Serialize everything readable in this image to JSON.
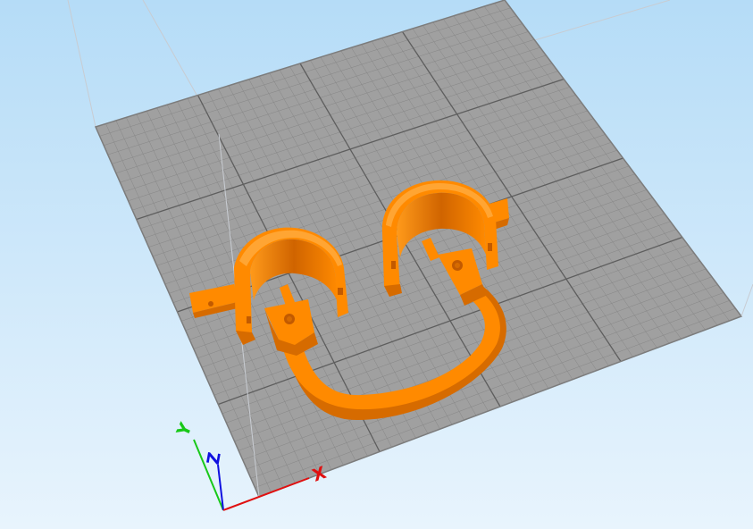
{
  "viewport": {
    "background_top": "#b5dcf7",
    "background_bottom": "#e8f4fd"
  },
  "bed": {
    "fill": "#a0a0a0",
    "grid_fine_color": "#868686",
    "grid_major_color": "#5e5e5e",
    "edge_color": "#7c7c7c",
    "build_volume_line_color": "#c8ccd2"
  },
  "model": {
    "color": "#ff8a00",
    "shadow_color": "#d66b00",
    "inner_color": "#c25a00",
    "highlight_color": "#ffa533",
    "parts": [
      "clamp-ring-left",
      "clamp-ring-right",
      "u-handle"
    ]
  },
  "axes": {
    "x_label": "X",
    "y_label": "Y",
    "z_label": "Z",
    "x_color": "#e01010",
    "y_color": "#18c818",
    "z_color": "#1010e0"
  }
}
